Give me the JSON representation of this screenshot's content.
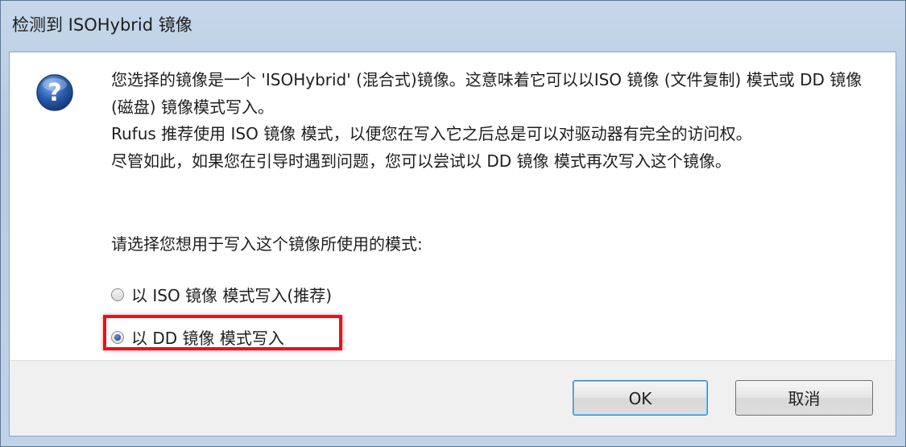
{
  "window": {
    "title": "检测到 ISOHybrid 镜像"
  },
  "icon": {
    "name": "question-icon",
    "glyph": "?",
    "color": "#2b5fae"
  },
  "message": {
    "lines": [
      "您选择的镜像是一个 'ISOHybrid' (混合式)镜像。这意味着它可以以ISO 镜像 (文件复制) 模式或 DD 镜像 (磁盘) 镜像模式写入。",
      "Rufus 推荐使用 ISO 镜像 模式，以便您在写入它之后总是可以对驱动器有完全的访问权。",
      "尽管如此，如果您在引导时遇到问题，您可以尝试以 DD 镜像 模式再次写入这个镜像。"
    ]
  },
  "prompt": "请选择您想用于写入这个镜像所使用的模式:",
  "options": [
    {
      "label": "以 ISO 镜像 模式写入(推荐)",
      "selected": false
    },
    {
      "label": "以 DD 镜像 模式写入",
      "selected": true
    }
  ],
  "buttons": {
    "ok": "OK",
    "cancel": "取消"
  },
  "colors": {
    "highlight_border": "#e8121b",
    "default_button_border": "#3c7fb1"
  }
}
